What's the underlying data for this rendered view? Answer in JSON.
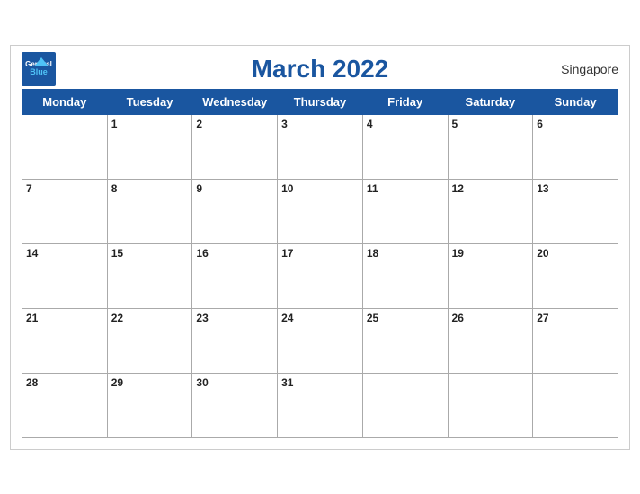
{
  "header": {
    "title": "March 2022",
    "region": "Singapore",
    "logo_general": "General",
    "logo_blue": "Blue"
  },
  "days_of_week": [
    "Monday",
    "Tuesday",
    "Wednesday",
    "Thursday",
    "Friday",
    "Saturday",
    "Sunday"
  ],
  "weeks": [
    [
      null,
      "1",
      "2",
      "3",
      "4",
      "5",
      "6"
    ],
    [
      "7",
      "8",
      "9",
      "10",
      "11",
      "12",
      "13"
    ],
    [
      "14",
      "15",
      "16",
      "17",
      "18",
      "19",
      "20"
    ],
    [
      "21",
      "22",
      "23",
      "24",
      "25",
      "26",
      "27"
    ],
    [
      "28",
      "29",
      "30",
      "31",
      null,
      null,
      null
    ]
  ]
}
